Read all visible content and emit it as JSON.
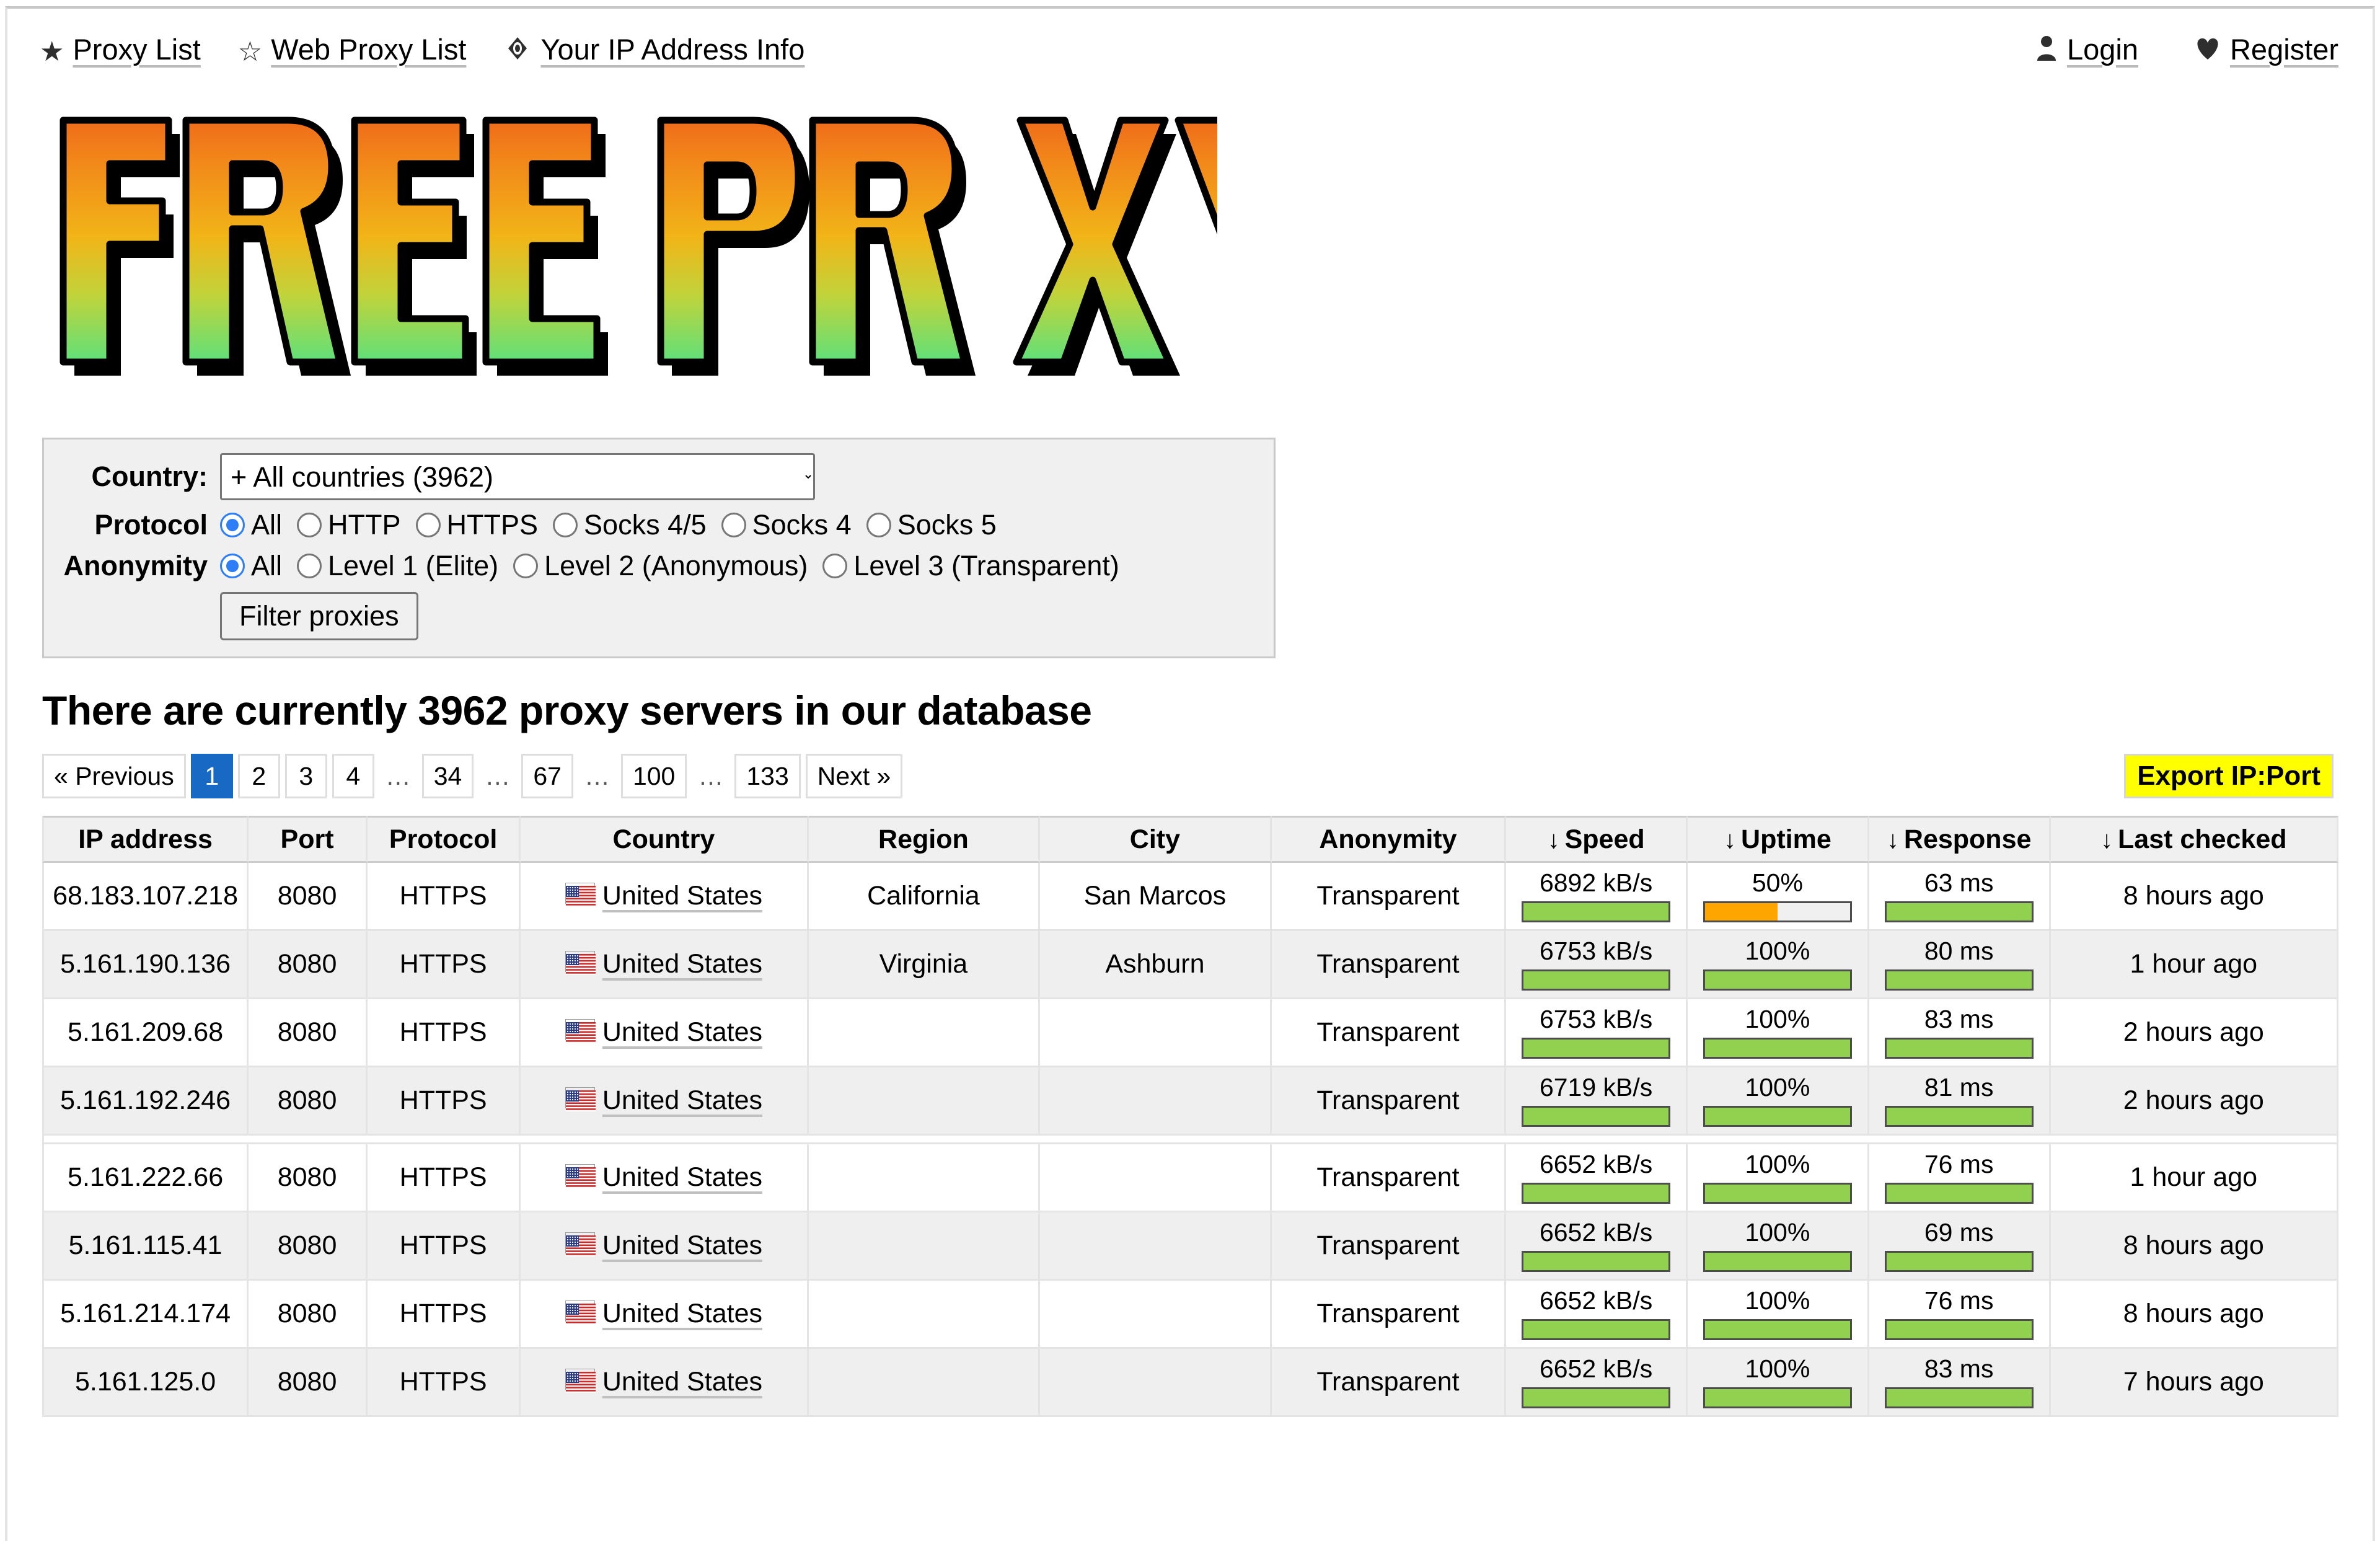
{
  "nav": {
    "left": [
      {
        "icon": "star-filled-icon",
        "glyph": "★",
        "label": "Proxy List"
      },
      {
        "icon": "star-outline-icon",
        "glyph": "☆",
        "label": "Web Proxy List"
      },
      {
        "icon": "eye-icon",
        "glyph": "◈",
        "label": "Your IP Address Info"
      }
    ],
    "right": [
      {
        "icon": "user-icon",
        "glyph": "♟",
        "label": "Login"
      },
      {
        "icon": "heart-icon",
        "glyph": "♥",
        "label": "Register"
      }
    ]
  },
  "logo": {
    "word1": "FREE",
    "word2": "PROXY",
    "gradient_top": "#ef6c1a",
    "gradient_mid": "#f5b316",
    "gradient_bottom": "#5fe07a"
  },
  "filter": {
    "country_label": "Country:",
    "country_value": "+ All countries (3962)",
    "protocol_label": "Protocol",
    "protocol_options": [
      "All",
      "HTTP",
      "HTTPS",
      "Socks 4/5",
      "Socks 4",
      "Socks 5"
    ],
    "protocol_selected": "All",
    "anonymity_label": "Anonymity",
    "anonymity_options": [
      "All",
      "Level 1 (Elite)",
      "Level 2 (Anonymous)",
      "Level 3 (Transparent)"
    ],
    "anonymity_selected": "All",
    "submit_label": "Filter proxies"
  },
  "headline": "There are currently 3962 proxy servers in our database",
  "pagination": {
    "previous": "« Previous",
    "next": "Next »",
    "pages": [
      "1",
      "2",
      "3",
      "4",
      "…",
      "34",
      "…",
      "67",
      "…",
      "100",
      "…",
      "133"
    ],
    "active": "1"
  },
  "export_button": "Export IP:Port",
  "table": {
    "columns": [
      {
        "label": "IP address",
        "sortable": false
      },
      {
        "label": "Port",
        "sortable": false
      },
      {
        "label": "Protocol",
        "sortable": false
      },
      {
        "label": "Country",
        "sortable": false
      },
      {
        "label": "Region",
        "sortable": false
      },
      {
        "label": "City",
        "sortable": false
      },
      {
        "label": "Anonymity",
        "sortable": false
      },
      {
        "label": "Speed",
        "sortable": true
      },
      {
        "label": "Uptime",
        "sortable": true
      },
      {
        "label": "Response",
        "sortable": true
      },
      {
        "label": "Last checked",
        "sortable": true
      }
    ],
    "sort_glyph": "↓",
    "rows": [
      {
        "ip": "68.183.107.218",
        "port": "8080",
        "protocol": "HTTPS",
        "country": "United States",
        "flag": "us-flag-icon",
        "region": "California",
        "city": "San Marcos",
        "anonymity": "Transparent",
        "speed": "6892 kB/s",
        "speed_pct": 100,
        "uptime": "50%",
        "uptime_pct": 50,
        "uptime_color": "orange",
        "response": "63 ms",
        "response_pct": 100,
        "last_checked": "8 hours ago"
      },
      {
        "ip": "5.161.190.136",
        "port": "8080",
        "protocol": "HTTPS",
        "country": "United States",
        "flag": "us-flag-icon",
        "region": "Virginia",
        "city": "Ashburn",
        "anonymity": "Transparent",
        "speed": "6753 kB/s",
        "speed_pct": 100,
        "uptime": "100%",
        "uptime_pct": 100,
        "uptime_color": "green",
        "response": "80 ms",
        "response_pct": 100,
        "last_checked": "1 hour ago"
      },
      {
        "ip": "5.161.209.68",
        "port": "8080",
        "protocol": "HTTPS",
        "country": "United States",
        "flag": "us-flag-icon",
        "region": "",
        "city": "",
        "anonymity": "Transparent",
        "speed": "6753 kB/s",
        "speed_pct": 100,
        "uptime": "100%",
        "uptime_pct": 100,
        "uptime_color": "green",
        "response": "83 ms",
        "response_pct": 100,
        "last_checked": "2 hours ago"
      },
      {
        "ip": "5.161.192.246",
        "port": "8080",
        "protocol": "HTTPS",
        "country": "United States",
        "flag": "us-flag-icon",
        "region": "",
        "city": "",
        "anonymity": "Transparent",
        "speed": "6719 kB/s",
        "speed_pct": 100,
        "uptime": "100%",
        "uptime_pct": 100,
        "uptime_color": "green",
        "response": "81 ms",
        "response_pct": 100,
        "last_checked": "2 hours ago"
      },
      {
        "ip": "5.161.222.66",
        "port": "8080",
        "protocol": "HTTPS",
        "country": "United States",
        "flag": "us-flag-icon",
        "region": "",
        "city": "",
        "anonymity": "Transparent",
        "speed": "6652 kB/s",
        "speed_pct": 100,
        "uptime": "100%",
        "uptime_pct": 100,
        "uptime_color": "green",
        "response": "76 ms",
        "response_pct": 100,
        "last_checked": "1 hour ago"
      },
      {
        "ip": "5.161.115.41",
        "port": "8080",
        "protocol": "HTTPS",
        "country": "United States",
        "flag": "us-flag-icon",
        "region": "",
        "city": "",
        "anonymity": "Transparent",
        "speed": "6652 kB/s",
        "speed_pct": 100,
        "uptime": "100%",
        "uptime_pct": 100,
        "uptime_color": "green",
        "response": "69 ms",
        "response_pct": 100,
        "last_checked": "8 hours ago"
      },
      {
        "ip": "5.161.214.174",
        "port": "8080",
        "protocol": "HTTPS",
        "country": "United States",
        "flag": "us-flag-icon",
        "region": "",
        "city": "",
        "anonymity": "Transparent",
        "speed": "6652 kB/s",
        "speed_pct": 100,
        "uptime": "100%",
        "uptime_pct": 100,
        "uptime_color": "green",
        "response": "76 ms",
        "response_pct": 100,
        "last_checked": "8 hours ago"
      },
      {
        "ip": "5.161.125.0",
        "port": "8080",
        "protocol": "HTTPS",
        "country": "United States",
        "flag": "us-flag-icon",
        "region": "",
        "city": "",
        "anonymity": "Transparent",
        "speed": "6652 kB/s",
        "speed_pct": 100,
        "uptime": "100%",
        "uptime_pct": 100,
        "uptime_color": "green",
        "response": "83 ms",
        "response_pct": 100,
        "last_checked": "7 hours ago"
      }
    ],
    "separator_after_row_index": 3
  }
}
